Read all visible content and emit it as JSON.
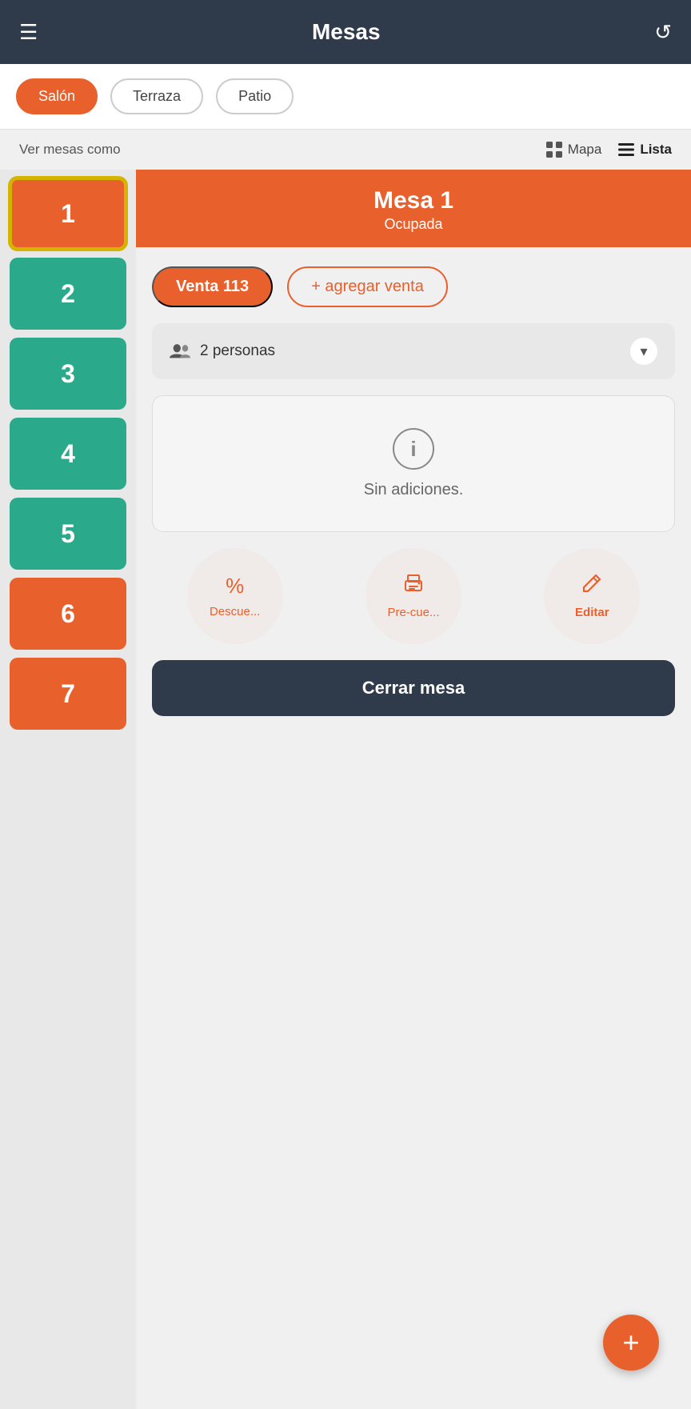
{
  "header": {
    "title": "Mesas",
    "hamburger_label": "☰",
    "refresh_label": "↺"
  },
  "tabs": [
    {
      "id": "salon",
      "label": "Salón",
      "active": true
    },
    {
      "id": "terraza",
      "label": "Terraza",
      "active": false
    },
    {
      "id": "patio",
      "label": "Patio",
      "active": false
    }
  ],
  "view_toggle": {
    "label": "Ver mesas como",
    "mapa_label": "Mapa",
    "lista_label": "Lista",
    "selected": "lista"
  },
  "tables": [
    {
      "number": "1",
      "status": "occupied",
      "selected": true
    },
    {
      "number": "2",
      "status": "available",
      "selected": false
    },
    {
      "number": "3",
      "status": "available",
      "selected": false
    },
    {
      "number": "4",
      "status": "available",
      "selected": false
    },
    {
      "number": "5",
      "status": "available",
      "selected": false
    },
    {
      "number": "6",
      "status": "occupied",
      "selected": false
    },
    {
      "number": "7",
      "status": "occupied",
      "selected": false
    }
  ],
  "detail": {
    "mesa_title": "Mesa 1",
    "status": "Ocupada",
    "venta_label": "Venta 113",
    "agregar_label": "+ agregar venta",
    "personas_label": "2 personas",
    "no_additions_text": "Sin adiciones.",
    "actions": [
      {
        "id": "descuento",
        "icon": "%",
        "label": "Descue..."
      },
      {
        "id": "precuenta",
        "icon": "print",
        "label": "Pre-cue..."
      },
      {
        "id": "editar",
        "icon": "pencil",
        "label": "Editar"
      }
    ],
    "close_button_label": "Cerrar mesa"
  },
  "fab": {
    "label": "+"
  },
  "colors": {
    "orange": "#e8602c",
    "teal": "#2aaa8a",
    "dark": "#2f3a4a",
    "yellow_outline": "#d4b400"
  }
}
